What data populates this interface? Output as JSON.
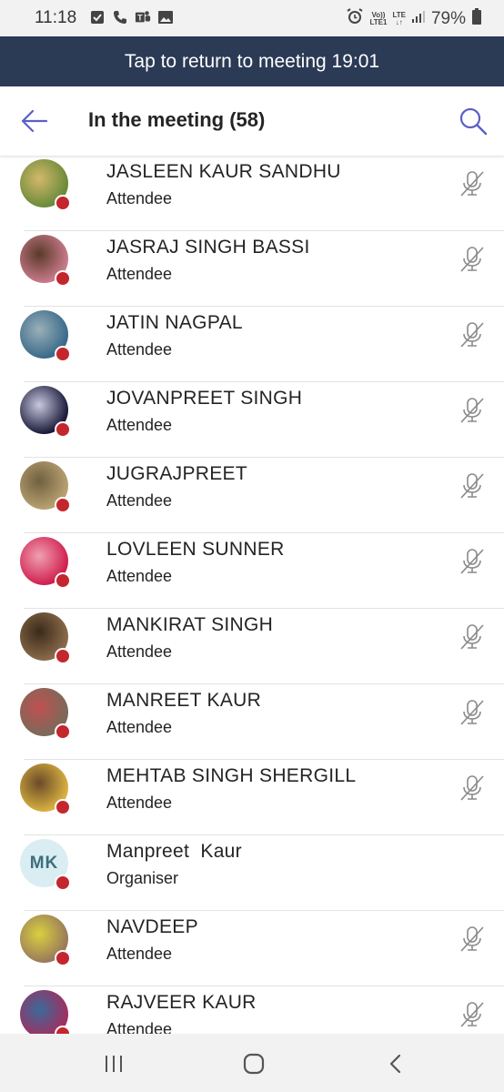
{
  "status_bar": {
    "time": "11:18",
    "network_top": "Vo))",
    "network_bottom": "LTE1",
    "lte_top": "LTE",
    "battery": "79%"
  },
  "banner": {
    "text": "Tap to return to meeting 19:01"
  },
  "header": {
    "title": "In the meeting (58)"
  },
  "colors": {
    "banner_bg": "#2b3a55",
    "accent": "#5b5fc7",
    "presence_busy": "#c4262e"
  },
  "participants": [
    {
      "name": "JASLEEN KAUR SANDHU",
      "role": "Attendee",
      "avatar": "photo",
      "muted": true
    },
    {
      "name": "JASRAJ SINGH BASSI",
      "role": "Attendee",
      "avatar": "photo",
      "muted": true
    },
    {
      "name": "JATIN NAGPAL",
      "role": "Attendee",
      "avatar": "photo",
      "muted": true
    },
    {
      "name": "JOVANPREET SINGH",
      "role": "Attendee",
      "avatar": "photo",
      "muted": true
    },
    {
      "name": "JUGRAJPREET",
      "role": "Attendee",
      "avatar": "photo",
      "muted": true
    },
    {
      "name": "LOVLEEN SUNNER",
      "role": "Attendee",
      "avatar": "photo",
      "muted": true
    },
    {
      "name": "MANKIRAT SINGH",
      "role": "Attendee",
      "avatar": "photo",
      "muted": true
    },
    {
      "name": "MANREET KAUR",
      "role": "Attendee",
      "avatar": "photo",
      "muted": true
    },
    {
      "name": "MEHTAB SINGH SHERGILL",
      "role": "Attendee",
      "avatar": "photo",
      "muted": true
    },
    {
      "name": "Manpreet  Kaur",
      "role": "Organiser",
      "avatar": "MK",
      "muted": false
    },
    {
      "name": "NAVDEEP",
      "role": "Attendee",
      "avatar": "photo",
      "muted": true
    },
    {
      "name": "RAJVEER KAUR",
      "role": "Attendee",
      "avatar": "photo",
      "muted": true
    }
  ],
  "icons": {
    "back": "arrow-left-icon",
    "search": "search-icon",
    "mic": "mic-off-icon",
    "nav_recent": "recent-apps-icon",
    "nav_home": "home-icon",
    "nav_back": "chevron-left-icon"
  }
}
